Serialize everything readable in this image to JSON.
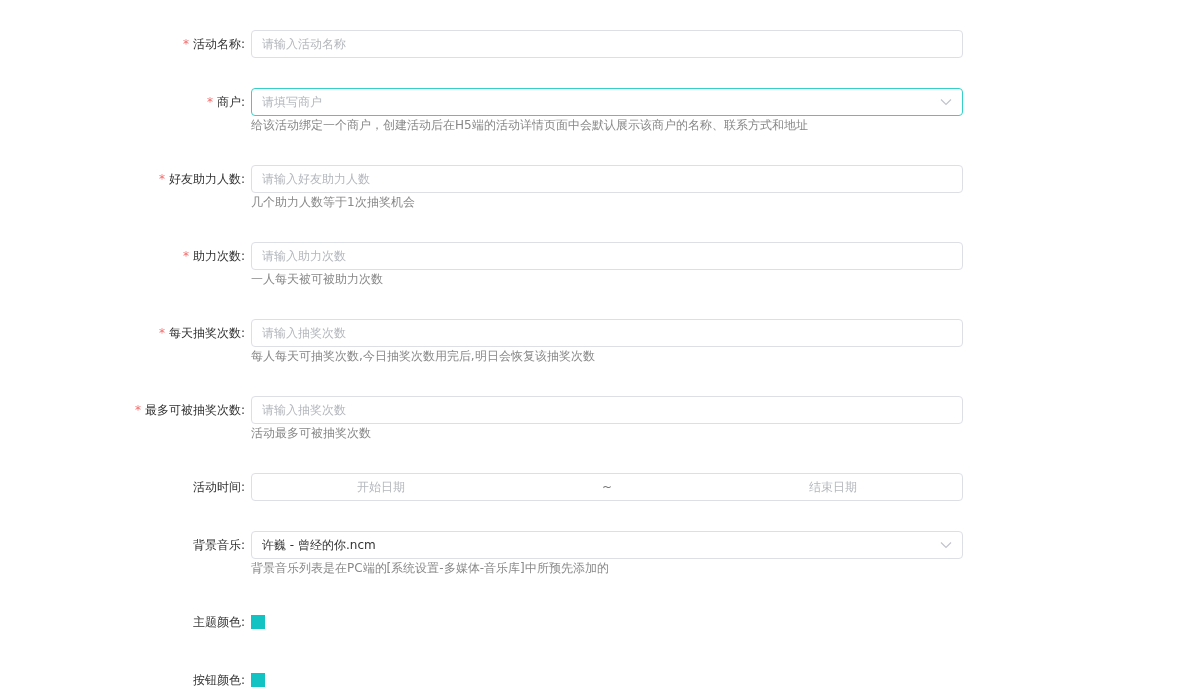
{
  "form": {
    "fields": [
      {
        "kind": "text",
        "required_mark": "*",
        "label": "活动名称:",
        "placeholder": "请输入活动名称"
      },
      {
        "kind": "select",
        "required_mark": "*",
        "label": "商户:",
        "placeholder": "请填写商户",
        "focused": true,
        "hint": "给该活动绑定一个商户，创建活动后在H5端的活动详情页面中会默认展示该商户的名称、联系方式和地址"
      },
      {
        "kind": "text",
        "required_mark": "*",
        "label": "好友助力人数:",
        "placeholder": "请输入好友助力人数",
        "hint": "几个助力人数等于1次抽奖机会"
      },
      {
        "kind": "text",
        "required_mark": "*",
        "label": "助力次数:",
        "placeholder": "请输入助力次数",
        "hint": "一人每天被可被助力次数"
      },
      {
        "kind": "text",
        "required_mark": "*",
        "label": "每天抽奖次数:",
        "placeholder": "请输入抽奖次数",
        "hint": "每人每天可抽奖次数,今日抽奖次数用完后,明日会恢复该抽奖次数"
      },
      {
        "kind": "text",
        "required_mark": "*",
        "label": "最多可被抽奖次数:",
        "placeholder": "请输入抽奖次数",
        "hint": "活动最多可被抽奖次数"
      },
      {
        "kind": "daterange",
        "label": "活动时间:",
        "start_placeholder": "开始日期",
        "separator": "~",
        "end_placeholder": "结束日期"
      },
      {
        "kind": "select",
        "label": "背景音乐:",
        "value": "许巍 - 曾经的你.ncm",
        "focused": false,
        "hint": "背景音乐列表是在PC端的[系统设置-多媒体-音乐库]中所预先添加的"
      },
      {
        "kind": "color",
        "label": "主题颜色:",
        "color": "#13c2c2"
      },
      {
        "kind": "color",
        "label": "按钮颜色:",
        "color": "#13c2c2"
      }
    ]
  }
}
